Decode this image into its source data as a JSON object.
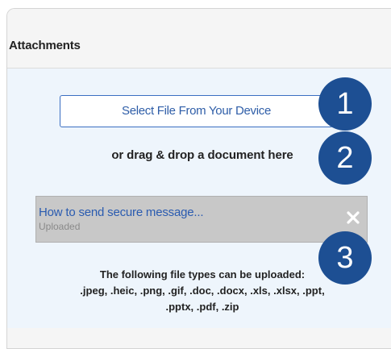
{
  "attachments": {
    "title": "Attachments",
    "select_button": "Select File From Your Device",
    "drag_text": "or drag & drop a document here",
    "file": {
      "name": "How to send secure message...",
      "status": "Uploaded"
    },
    "types_line1": "The following file types can be uploaded:",
    "types_line2": ".jpeg, .heic, .png, .gif, .doc, .docx, .xls, .xlsx, .ppt,",
    "types_line3": ".pptx, .pdf, .zip"
  },
  "callouts": [
    "1",
    "2",
    "3"
  ],
  "colors": {
    "accent": "#3b6fc2",
    "badge": "#1d4f93",
    "panel_bg": "#eef5fc"
  }
}
